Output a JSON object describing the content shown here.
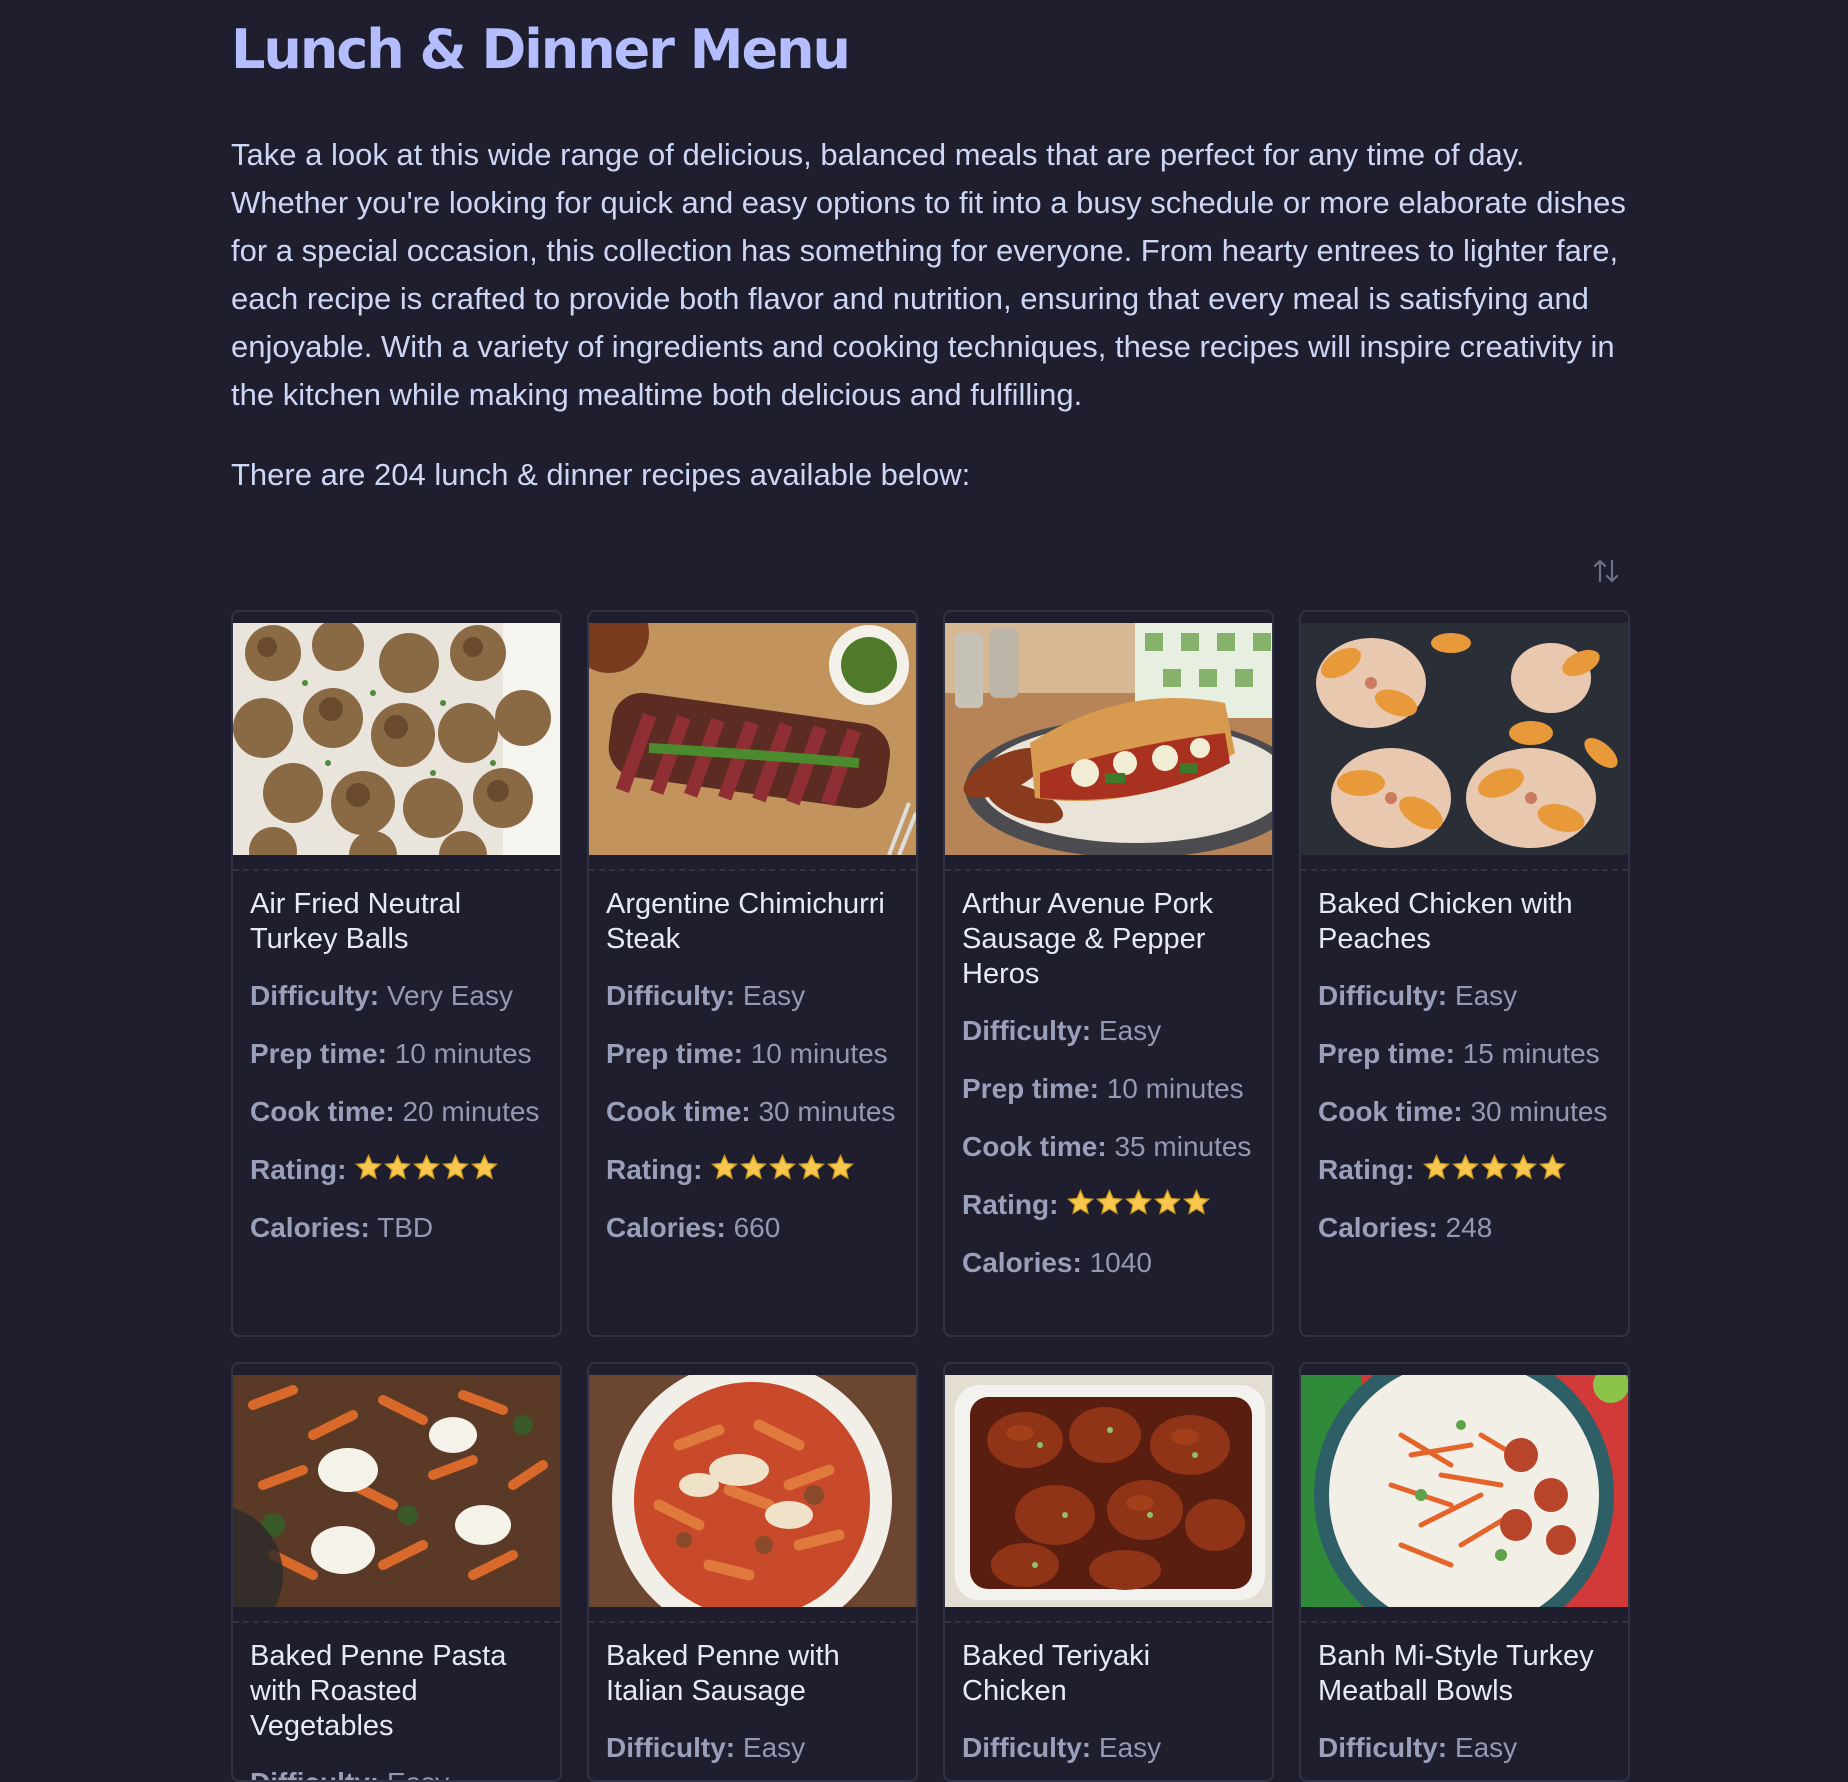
{
  "page": {
    "title": "Lunch & Dinner Menu",
    "intro": "Take a look at this wide range of delicious, balanced meals that are perfect for any time of day. Whether you're looking for quick and easy options to fit into a busy schedule or more elaborate dishes for a special occasion, this collection has something for everyone. From hearty entrees to lighter fare, each recipe is crafted to provide both flavor and nutrition, ensuring that every meal is satisfying and enjoyable. With a variety of ingredients and cooking techniques, these recipes will inspire creativity in the kitchen while making mealtime both delicious and fulfilling.",
    "count_text": "There are 204 lunch & dinner recipes available below:",
    "sort_icon": "sort-arrows-icon"
  },
  "labels": {
    "difficulty": "Difficulty:",
    "prep_time": "Prep time:",
    "cook_time": "Cook time:",
    "rating": "Rating:",
    "calories": "Calories:"
  },
  "colors": {
    "background": "#1e1e2e",
    "title": "#b4befe",
    "text": "#cdd6f4",
    "meta": "#9399b2",
    "border": "#313244",
    "star": "#f9c74f"
  },
  "recipes": [
    {
      "name": "Air Fried Neutral Turkey Balls",
      "difficulty": "Very Easy",
      "prep": "10 minutes",
      "cook": "20 minutes",
      "rating": 5,
      "calories": "TBD"
    },
    {
      "name": "Argentine Chimichurri Steak",
      "difficulty": "Easy",
      "prep": "10 minutes",
      "cook": "30 minutes",
      "rating": 5,
      "calories": "660"
    },
    {
      "name": "Arthur Avenue Pork Sausage & Pepper Heros",
      "difficulty": "Easy",
      "prep": "10 minutes",
      "cook": "35 minutes",
      "rating": 5,
      "calories": "1040"
    },
    {
      "name": "Baked Chicken with Peaches",
      "difficulty": "Easy",
      "prep": "15 minutes",
      "cook": "30 minutes",
      "rating": 5,
      "calories": "248"
    },
    {
      "name": "Baked Penne Pasta with Roasted Vegetables",
      "difficulty": "Easy"
    },
    {
      "name": "Baked Penne with Italian Sausage",
      "difficulty": "Easy"
    },
    {
      "name": "Baked Teriyaki Chicken",
      "difficulty": "Easy"
    },
    {
      "name": "Banh Mi-Style Turkey Meatball Bowls",
      "difficulty": "Easy"
    }
  ]
}
